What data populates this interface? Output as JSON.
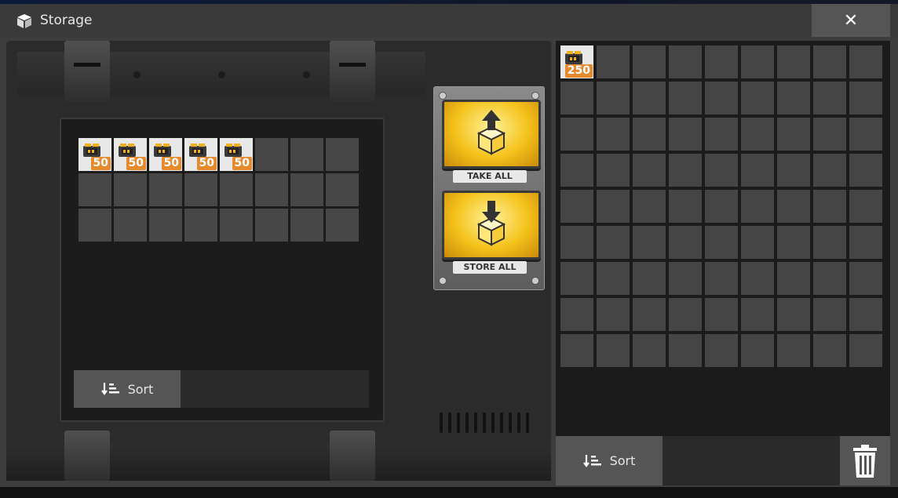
{
  "window": {
    "title": "Storage",
    "close_label": "✕"
  },
  "storage": {
    "rows": 3,
    "cols": 8,
    "items": [
      {
        "slot": 0,
        "icon": "battery-icon",
        "count": "50"
      },
      {
        "slot": 1,
        "icon": "battery-icon",
        "count": "50"
      },
      {
        "slot": 2,
        "icon": "battery-icon",
        "count": "50"
      },
      {
        "slot": 3,
        "icon": "battery-icon",
        "count": "50"
      },
      {
        "slot": 4,
        "icon": "battery-icon",
        "count": "50"
      }
    ],
    "sort_label": "Sort"
  },
  "actions": {
    "take_all_label": "TAKE ALL",
    "store_all_label": "STORE ALL"
  },
  "inventory": {
    "rows": 9,
    "cols": 9,
    "items": [
      {
        "slot": 0,
        "icon": "battery-icon",
        "count": "250"
      }
    ],
    "sort_label": "Sort"
  },
  "colors": {
    "accent_orange": "#e68a2e",
    "button_yellow": "#f4c21b"
  }
}
